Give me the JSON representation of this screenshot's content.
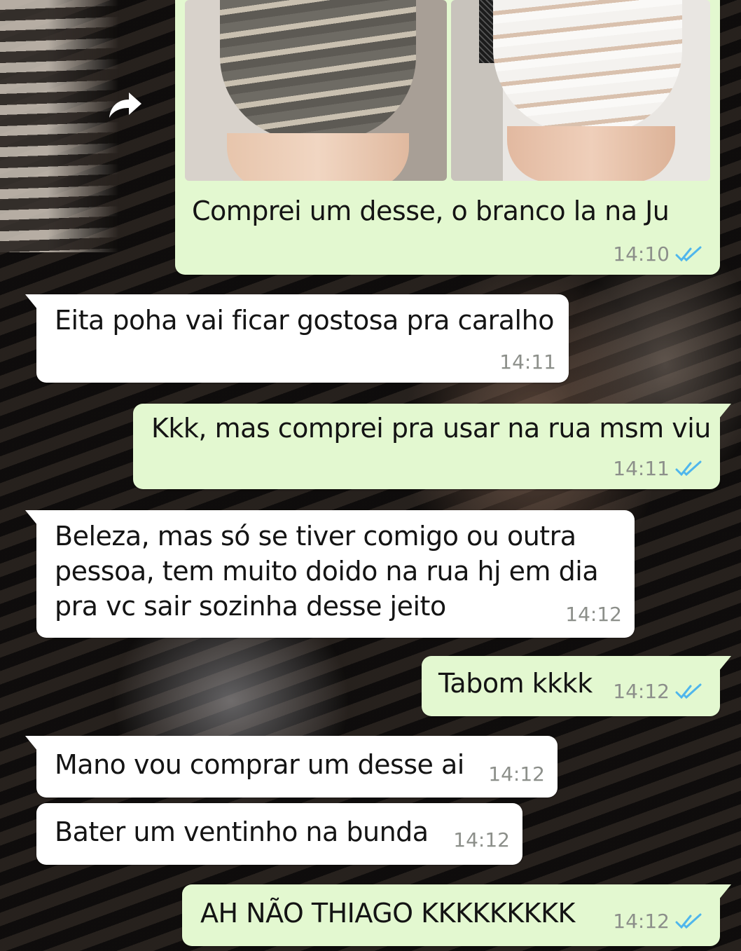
{
  "messages": [
    {
      "direction": "outgoing",
      "text": "Comprei um desse, o branco la na Ju",
      "time": "14:10",
      "status": "read",
      "attachment": "two-photos"
    },
    {
      "direction": "incoming",
      "text": "Eita poha vai ficar gostosa pra caralho",
      "time": "14:11"
    },
    {
      "direction": "outgoing",
      "text": "Kkk, mas comprei pra usar na rua msm viu",
      "time": "14:11",
      "status": "read"
    },
    {
      "direction": "incoming",
      "lines": [
        "Beleza, mas só se tiver comigo ou outra",
        "pessoa, tem muito doido na rua hj em dia",
        "pra vc sair sozinha desse jeito"
      ],
      "time": "14:12"
    },
    {
      "direction": "outgoing",
      "text": "Tabom kkkk",
      "time": "14:12",
      "status": "read"
    },
    {
      "direction": "incoming",
      "text": "Mano vou comprar um desse ai",
      "time": "14:12"
    },
    {
      "direction": "incoming",
      "text": "Bater um ventinho na bunda",
      "time": "14:12"
    },
    {
      "direction": "outgoing",
      "text": "AH NÃO THIAGO KKKKKKKKK",
      "time": "14:12",
      "status": "read"
    }
  ],
  "icons": {
    "forward": "forward-arrow-icon",
    "read_receipt": "double-check-icon"
  },
  "colors": {
    "outgoing_bubble": "#e3f8d0",
    "incoming_bubble": "#ffffff",
    "read_ticks": "#4fb6ec",
    "timestamp": "#8c8f8a"
  }
}
